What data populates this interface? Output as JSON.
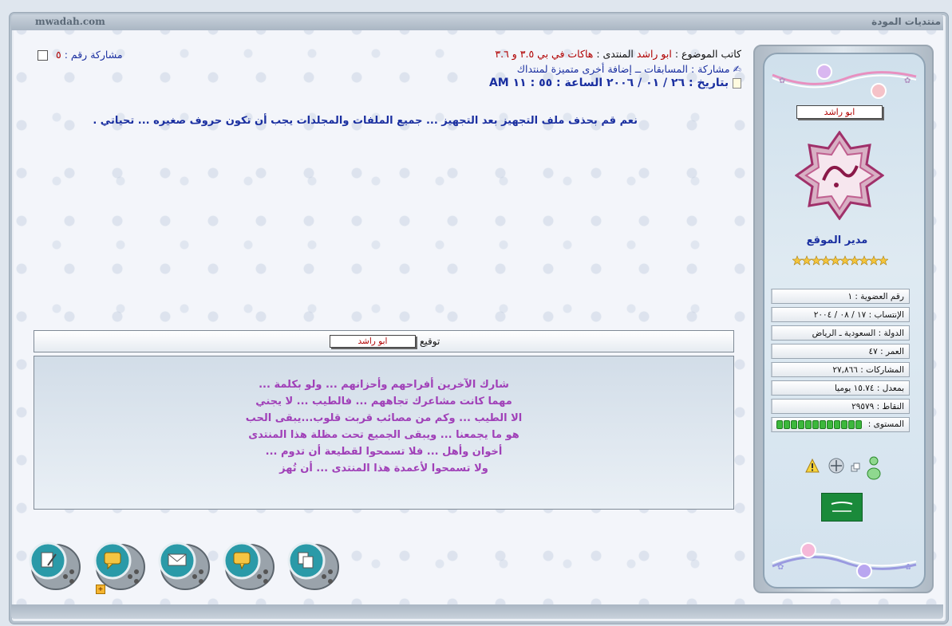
{
  "site": {
    "domain": "mwadah.com",
    "name": "منتديات المودة"
  },
  "post": {
    "author_label": "كاتب الموضوع :",
    "author": "ابو راشد",
    "forum_label": "المنتدى :",
    "forum": "هاكات في بي ٣.٥ و ٣.٦",
    "reply_label": "مشاركة :",
    "reply_title": "المسابقات ــ إضافة أخرى متميزة لمنتداك",
    "date": "بتاريخ : ٢٦ / ٠١ / ٢٠٠٦ الساعة : ٥٥ : ١١ AM",
    "number_label": "مشاركة رقم :",
    "number": "٥",
    "body": "نعم قم بحذف ملف التجهيز بعد التجهيز ... جميع الملفات والمجلدات يجب أن تكون حروف صغيره ... تحياتي ."
  },
  "signature": {
    "label": "توقيع",
    "name": "ابو راشد",
    "lines": [
      "شارك الآخرين أفراحهم وأحزانهم ... ولو بكلمة ...",
      "مهما كانت مشاعرك تجاههم ... فالطيب ... لا يجني",
      "الا الطيب ... وكم من مصائب قربت قلوب...يبقى الحب",
      "هو ما يجمعنا ... ويبقى الجميع تحت مظلة هذا المنتدى",
      "أخوان وأهل ... فلا تسمحوا لقطيعة أن تدوم ...",
      "ولا تسمحوا لأعمدة هذا المنتدى ... أن تُهز"
    ]
  },
  "profile": {
    "name": "ابو راشد",
    "rank": "مدير الموقع",
    "stars": 10,
    "info": [
      "رقم العضوية : ١",
      "الإنتساب : ١٧ / ٠٨ / ٢٠٠٤",
      "الدولة : السعودية ـ الرياض",
      "العمر : ٤٧",
      "المشاركات : ٢٧,٨٦٦",
      "بمعدل : ١٥.٧٤ يوميا",
      "النقاط : ٢٩٥٧٩"
    ],
    "level_label": "المستوى :",
    "level_segments": 12
  },
  "colors": {
    "link_blue": "#1a2fa0",
    "accent_red": "#b00000",
    "signature_purple": "#a040b8"
  },
  "actions": [
    {
      "icon": "copy-icon"
    },
    {
      "icon": "quote-icon"
    },
    {
      "icon": "send-message-icon"
    },
    {
      "icon": "reply-icon"
    },
    {
      "icon": "edit-icon"
    }
  ]
}
